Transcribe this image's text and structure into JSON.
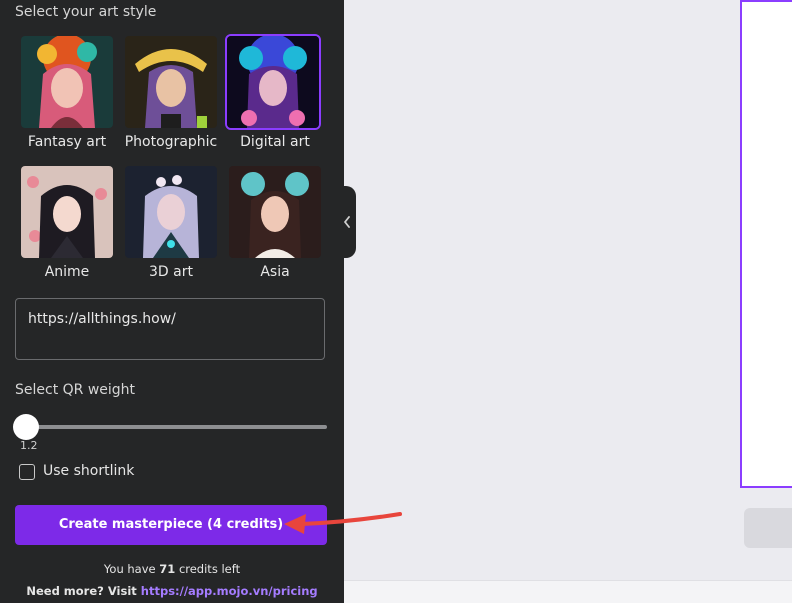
{
  "panel": {
    "art_style_title": "Select your art style",
    "styles": [
      {
        "label": "Fantasy art",
        "selected": false,
        "icon": "fantasy-portrait-image"
      },
      {
        "label": "Photographic",
        "selected": false,
        "icon": "photographic-portrait-image"
      },
      {
        "label": "Digital art",
        "selected": true,
        "icon": "digital-portrait-image"
      },
      {
        "label": "Anime",
        "selected": false,
        "icon": "anime-portrait-image"
      },
      {
        "label": "3D art",
        "selected": false,
        "icon": "3d-portrait-image"
      },
      {
        "label": "Asia",
        "selected": false,
        "icon": "asia-portrait-image"
      }
    ],
    "url_value": "https://allthings.how/",
    "qr_weight_title": "Select QR weight",
    "qr_weight_value": "1.2",
    "qr_weight_fraction": 0.0,
    "shortlink_label": "Use shortlink",
    "shortlink_checked": false,
    "create_button_label": "Create masterpiece (4 credits)",
    "credits_prefix": "You have",
    "credits_count": "71",
    "credits_suffix": "credits left",
    "need_more_text": "Need more? Visit",
    "pricing_link": "https://app.mojo.vn/pricing"
  },
  "colors": {
    "panel_bg": "#252627",
    "accent": "#7d2ae8",
    "selected_border": "#8b3dff",
    "annotation_arrow": "#e8453c",
    "link": "#a57cff"
  }
}
